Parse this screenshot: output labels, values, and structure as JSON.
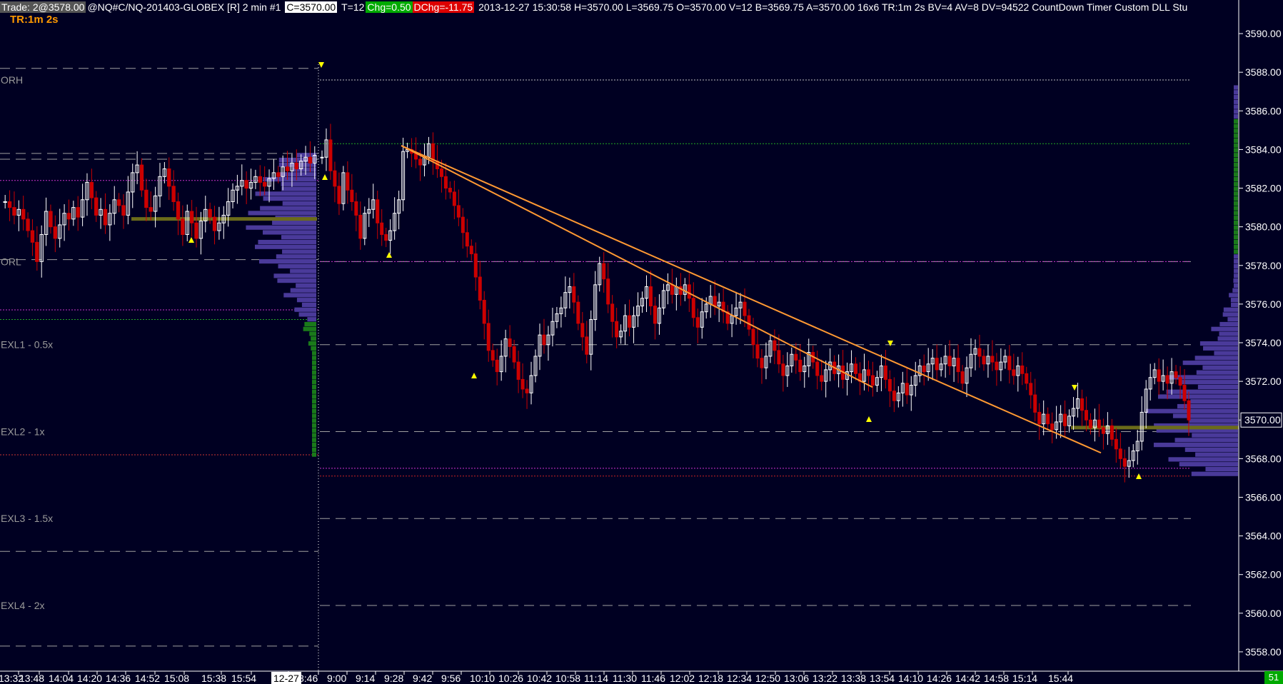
{
  "header": {
    "trade": "Trade: 2@3578.00",
    "symbol": "@NQ#C/NQ-201403-GLOBEX [R]  2 min   #1",
    "close": "C=3570.00",
    "ticks": "T=12",
    "chg": "Chg=0.50",
    "dchg": "DChg=-11.75",
    "info": "2013-12-27 15:30:58 H=3570.00 L=3569.75 O=3570.00 V=12 B=3569.75 A=3570.00 16x6 TR:1m 2s BV=4 AV=8 DV=94522  CountDown Timer  Custom DLL Stu",
    "timer": "TR:1m 2s",
    "timer_badge": "51"
  },
  "colors": {
    "background": "#000022",
    "up_candle": "#ffffff",
    "down_candle": "#cc0000",
    "volume_profile_high": "#1a7a1a",
    "volume_profile_low": "#4a3a9a",
    "trendline": "#ff9933",
    "marker": "#ffff00",
    "level_line": "#a0a0a0",
    "price_box": "#ffffff"
  },
  "chart_data": {
    "type": "candlestick",
    "instrument": "@NQ#C/NQ-201403-GLOBEX",
    "interval": "2 min",
    "ylim": [
      3557,
      3591
    ],
    "y_ticks": [
      3590,
      3588,
      3586,
      3584,
      3582,
      3580,
      3578,
      3576,
      3574,
      3572,
      3570,
      3568,
      3566,
      3564,
      3562,
      3560,
      3558
    ],
    "y_tick_labels": [
      "3590.00",
      "3588.00",
      "3586.00",
      "3584.00",
      "3582.00",
      "3580.00",
      "3578.00",
      "3576.00",
      "3574.00",
      "3572.00",
      "3570.00",
      "3568.00",
      "3566.00",
      "3564.00",
      "3562.00",
      "3560.00",
      "3558.00"
    ],
    "x_tick_labels": [
      "13:32",
      "13:48",
      "14:04",
      "14:20",
      "14:36",
      "14:52",
      "15:08",
      "15:38",
      "15:54",
      "12-27",
      "8:46",
      "9:00",
      "9:14",
      "9:28",
      "9:42",
      "9:56",
      "10:10",
      "10:26",
      "10:42",
      "10:58",
      "11:14",
      "11:30",
      "11:46",
      "12:02",
      "12:18",
      "12:34",
      "12:50",
      "13:06",
      "13:22",
      "13:38",
      "13:54",
      "14:10",
      "14:26",
      "14:42",
      "14:58",
      "15:14",
      "15:44"
    ],
    "current_price": 3570.0,
    "current_price_label": "3570.00",
    "levels": [
      {
        "label": "ORH",
        "value": 3587.6
      },
      {
        "label": "ORL",
        "value": 3578.2
      },
      {
        "label": "EXL1 - 0.5x",
        "value": 3573.9
      },
      {
        "label": "EXL2 - 1x",
        "value": 3569.4
      },
      {
        "label": "EXL3 - 1.5x",
        "value": 3564.9
      },
      {
        "label": "EXL4 - 2x",
        "value": 3560.4
      }
    ],
    "prev_session_levels": [
      3588.2,
      3583.8,
      3583.5,
      3578.3,
      3563.2,
      3558.3
    ],
    "session_lines": [
      {
        "value": 3587.6,
        "color": "#c0c0c0"
      },
      {
        "value": 3584.3,
        "color": "#22aa22"
      },
      {
        "value": 3578.2,
        "color": "#cc33cc"
      },
      {
        "value": 3567.5,
        "color": "#cc33cc"
      },
      {
        "value": 3567.1,
        "color": "#cc2222"
      }
    ],
    "prev_lines": [
      {
        "value": 3582.4,
        "color": "#cc33cc"
      },
      {
        "value": 3575.7,
        "color": "#cc33cc"
      },
      {
        "value": 3575.2,
        "color": "#22aa22"
      },
      {
        "value": 3568.2,
        "color": "#cc3333"
      }
    ],
    "series_prev_session": [
      3581.3,
      3581.0,
      3580.6,
      3580.9,
      3580.4,
      3579.8,
      3579.2,
      3578.2,
      3579.6,
      3580.8,
      3580.0,
      3579.4,
      3580.1,
      3580.7,
      3580.4,
      3581.0,
      3580.5,
      3581.4,
      3582.3,
      3581.5,
      3580.6,
      3580.9,
      3580.1,
      3580.7,
      3581.4,
      3581.1,
      3580.6,
      3581.8,
      3582.8,
      3583.2,
      3581.9,
      3581.0,
      3580.8,
      3581.6,
      3582.6,
      3583.0,
      3582.1,
      3581.3,
      3580.4,
      3579.6,
      3580.8,
      3580.2,
      3579.4,
      3580.3,
      3580.9,
      3580.5,
      3579.8,
      3580.2,
      3580.6,
      3581.3,
      3581.9,
      3582.1,
      3582.4,
      3582.0,
      3582.3,
      3582.6,
      3582.3,
      3582.1,
      3582.5,
      3582.8,
      3582.6,
      3583.1,
      3582.9,
      3583.3,
      3583.0,
      3583.4,
      3583.6,
      3583.3,
      3583.7
    ],
    "series_session": [
      3583.6,
      3584.5,
      3582.9,
      3582.1,
      3581.2,
      3582.8,
      3581.9,
      3581.3,
      3580.6,
      3579.4,
      3580.7,
      3580.9,
      3581.4,
      3580.2,
      3579.6,
      3579.3,
      3579.8,
      3580.7,
      3581.4,
      3583.9,
      3584.0,
      3583.8,
      3583.5,
      3583.2,
      3583.6,
      3584.3,
      3583.4,
      3583.0,
      3582.6,
      3582.0,
      3581.8,
      3581.1,
      3580.5,
      3579.7,
      3579.0,
      3578.6,
      3577.4,
      3576.2,
      3575.0,
      3573.6,
      3573.1,
      3572.5,
      3573.3,
      3574.2,
      3573.8,
      3573.0,
      3572.1,
      3571.6,
      3571.4,
      3572.3,
      3573.3,
      3574.4,
      3573.9,
      3574.4,
      3575.1,
      3575.5,
      3575.8,
      3576.6,
      3576.9,
      3576.1,
      3575.0,
      3574.3,
      3573.4,
      3575.2,
      3577.0,
      3578.1,
      3577.3,
      3576.0,
      3575.1,
      3574.3,
      3574.6,
      3575.4,
      3574.8,
      3575.4,
      3575.9,
      3576.3,
      3576.9,
      3575.9,
      3575.0,
      3575.8,
      3576.7,
      3577.0,
      3576.5,
      3576.9,
      3576.5,
      3577.0,
      3576.3,
      3575.3,
      3574.8,
      3575.6,
      3576.0,
      3576.4,
      3575.9,
      3576.1,
      3575.6,
      3575.0,
      3575.4,
      3575.8,
      3576.1,
      3575.4,
      3574.7,
      3573.9,
      3573.2,
      3572.7,
      3573.3,
      3574.1,
      3573.6,
      3572.9,
      3572.3,
      3572.8,
      3573.4,
      3573.1,
      3572.5,
      3572.8,
      3573.5,
      3573.0,
      3572.3,
      3572.0,
      3572.6,
      3573.0,
      3572.4,
      3572.8,
      3572.1,
      3572.5,
      3572.9,
      3572.4,
      3572.0,
      3572.6,
      3572.3,
      3571.8,
      3572.2,
      3572.8,
      3572.1,
      3571.5,
      3571.0,
      3571.4,
      3571.9,
      3571.3,
      3571.8,
      3572.3,
      3572.8,
      3572.5,
      3572.9,
      3573.2,
      3572.6,
      3572.9,
      3573.3,
      3572.8,
      3573.2,
      3572.5,
      3571.9,
      3572.7,
      3573.4,
      3573.7,
      3573.3,
      3572.9,
      3573.3,
      3573.0,
      3572.6,
      3573.0,
      3573.3,
      3572.6,
      3572.3,
      3572.8,
      3572.4,
      3571.9,
      3571.3,
      3570.4,
      3569.8,
      3570.3,
      3569.8,
      3569.5,
      3569.9,
      3570.3,
      3569.7,
      3570.2,
      3570.6,
      3571.1,
      3570.5,
      3570.0,
      3569.6,
      3570.0,
      3569.6,
      3569.3,
      3569.7,
      3569.0,
      3568.5,
      3568.0,
      3567.6,
      3567.9,
      3568.4,
      3568.9,
      3570.4,
      3571.6,
      3572.2,
      3572.6,
      3572.0,
      3572.3,
      3571.9,
      3572.5,
      3572.2,
      3571.8,
      3571.0,
      3570.0
    ],
    "trendlines": [
      {
        "from": {
          "x": "9:00",
          "y": 3584.2
        },
        "to": {
          "x": "14:58",
          "y": 3568.3
        }
      },
      {
        "from": {
          "x": "9:00",
          "y": 3584.2
        },
        "to": {
          "x": "12:50",
          "y": 3571.7
        }
      }
    ],
    "volume_profile": "horizontal bars at right edge of each session"
  }
}
